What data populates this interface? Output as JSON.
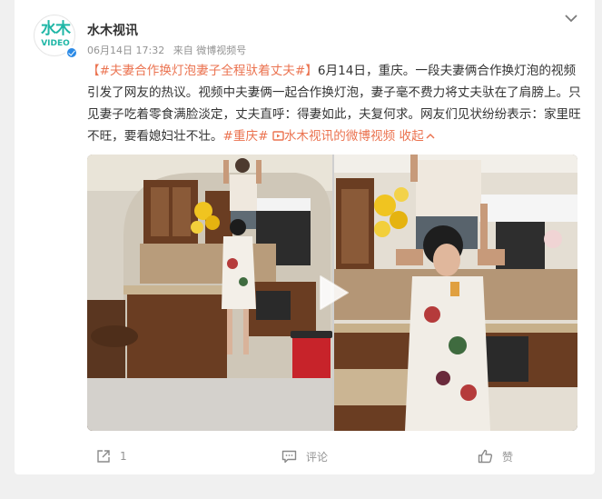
{
  "post": {
    "author": "水木视讯",
    "logo_top": "水木",
    "logo_bottom": "VIDEO",
    "date": "06月14日 17:32",
    "source": "来自 微博视频号",
    "topic_tag": "【#夫妻合作换灯泡妻子全程驮着丈夫#】",
    "body": "6月14日，重庆。一段夫妻俩合作换灯泡的视频引发了网友的热议。视频中夫妻俩一起合作换灯泡，妻子毫不费力将丈夫驮在了肩膀上。只见妻子吃着零食满脸淡定，丈夫直呼：得妻如此，夫复何求。网友们见状纷纷表示：家里旺不旺，要看媳妇壮不壮。",
    "location_tag": "#重庆#",
    "video_link": "水木视讯的微博视频",
    "collapse": "收起"
  },
  "actions": {
    "share_count": "1",
    "comment_label": "评论",
    "like_label": "赞"
  },
  "colors": {
    "accent": "#eb7350",
    "brand": "#1fb6a6",
    "verify": "#2b8ae6"
  },
  "icons": [
    "chevron-down-icon",
    "verified-badge-icon",
    "link-video-icon",
    "chevron-up-icon",
    "play-icon",
    "share-icon",
    "comment-icon",
    "like-icon"
  ]
}
